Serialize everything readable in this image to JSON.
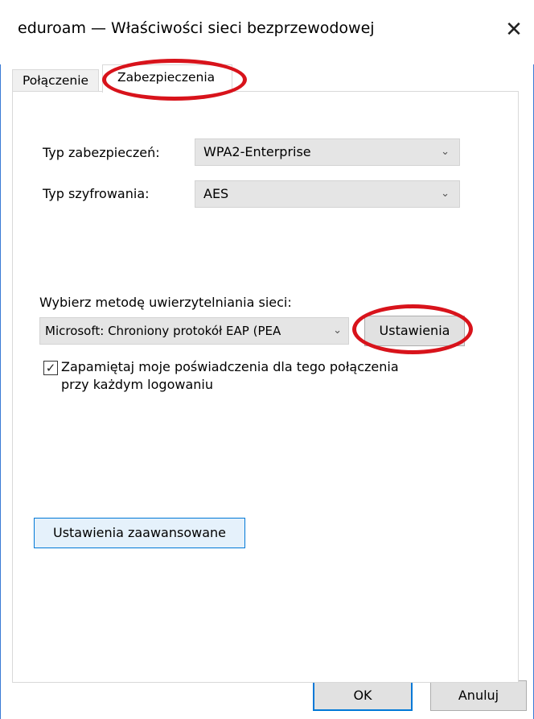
{
  "window": {
    "title": "eduroam — Właściwości sieci bezprzewodowej",
    "close_glyph": "✕"
  },
  "tabs": [
    {
      "label": "Połączenie",
      "active": false
    },
    {
      "label": "Zabezpieczenia",
      "active": true
    }
  ],
  "security": {
    "type_label": "Typ zabezpieczeń:",
    "type_value": "WPA2-Enterprise",
    "encryption_label": "Typ szyfrowania:",
    "encryption_value": "AES"
  },
  "auth": {
    "method_label": "Wybierz metodę uwierzytelniania sieci:",
    "method_value": "Microsoft: Chroniony protokół EAP (PEA",
    "settings_button": "Ustawienia",
    "remember_checked": true,
    "remember_label_line1": "Zapamiętaj moje poświadczenia dla tego połączenia",
    "remember_label_line2": "przy każdym logowaniu"
  },
  "advanced_button": "Ustawienia zaawansowane",
  "footer": {
    "ok": "OK",
    "cancel": "Anuluj"
  },
  "icons": {
    "chevron": "chevron-down-icon",
    "check": "checkmark-icon",
    "close": "close-icon"
  },
  "colors": {
    "accent": "#0078d7",
    "annotation": "#d8131b"
  }
}
